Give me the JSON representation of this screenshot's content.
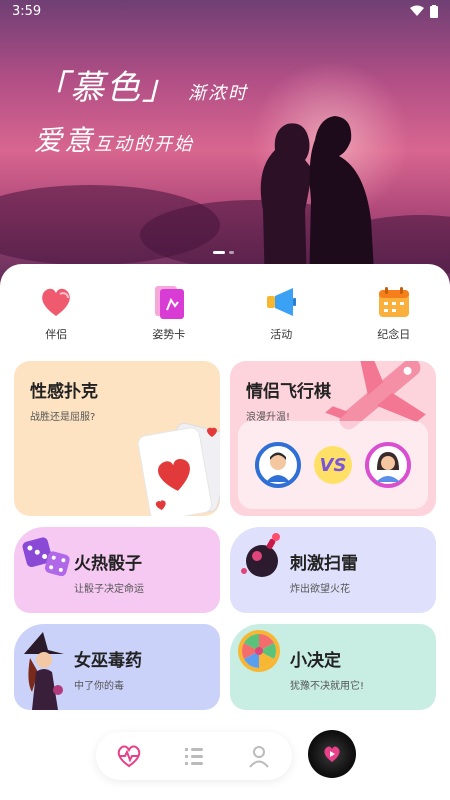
{
  "status_bar": {
    "time": "3:59"
  },
  "hero": {
    "title_main": "「慕色」",
    "title_sub": "渐浓时",
    "line2_main": "爱意",
    "line2_sub": "互动的开始"
  },
  "quick_nav": [
    {
      "label": "伴侣",
      "icon": "heart-icon"
    },
    {
      "label": "姿势卡",
      "icon": "pose-card-icon"
    },
    {
      "label": "活动",
      "icon": "megaphone-icon"
    },
    {
      "label": "纪念日",
      "icon": "calendar-icon"
    }
  ],
  "cards": {
    "poker": {
      "title": "性感扑克",
      "subtitle": "战胜还是屈服?"
    },
    "flight_chess": {
      "title": "情侣飞行棋",
      "subtitle": "浪漫升温!",
      "vs": "VS"
    },
    "dice": {
      "title": "火热骰子",
      "subtitle": "让骰子决定命运"
    },
    "minesweeper": {
      "title": "刺激扫雷",
      "subtitle": "炸出欲望火花"
    },
    "witch": {
      "title": "女巫毒药",
      "subtitle": "中了你的毒"
    },
    "decision": {
      "title": "小决定",
      "subtitle": "犹豫不决就用它!"
    }
  },
  "bottom_nav": [
    {
      "icon": "heart-pulse-icon",
      "active": true
    },
    {
      "icon": "list-icon",
      "active": false
    },
    {
      "icon": "profile-icon",
      "active": false
    }
  ],
  "colors": {
    "accent_pink": "#e9408a",
    "poker_bg": "#fde3c2",
    "plane_bg": "#fdd3dc",
    "dice_bg": "#f6c9f2",
    "mine_bg": "#dfe0fb",
    "witch_bg": "#cbd2fa",
    "decision_bg": "#c8ede3"
  }
}
